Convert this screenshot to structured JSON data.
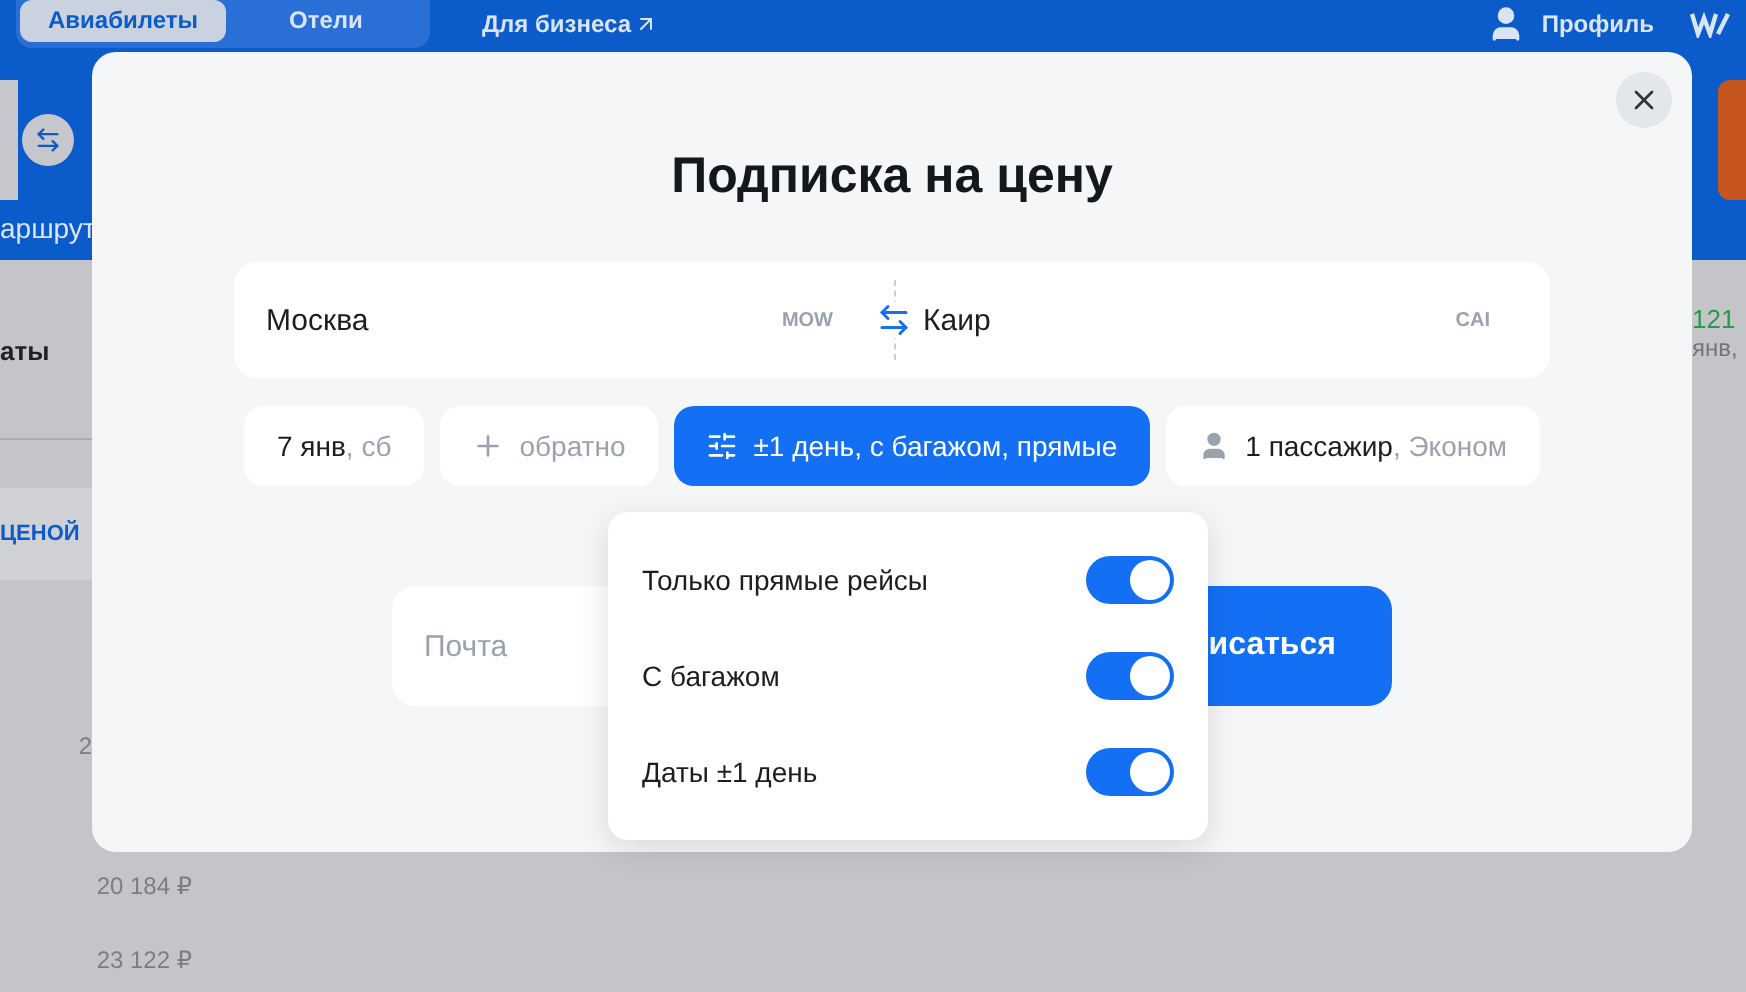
{
  "nav": {
    "tabs": [
      {
        "label": "Авиабилеты",
        "selected": true
      },
      {
        "label": "Отели",
        "selected": false
      }
    ],
    "business_link": "Для бизнеса",
    "profile": "Профиль"
  },
  "background": {
    "route_label": "аршрут",
    "dates_label": "аты",
    "price_banner": "ЦЕНОЙ",
    "best_price": "121",
    "best_date": "янв,",
    "prices": [
      "2",
      "20 184 ₽",
      "23 122 ₽"
    ]
  },
  "modal": {
    "title": "Подписка на цену",
    "origin": {
      "city": "Москва",
      "code": "MOW"
    },
    "destination": {
      "city": "Каир",
      "code": "CAI"
    },
    "depart": {
      "date": "7 янв",
      "weekday": ", сб"
    },
    "return": {
      "placeholder": "обратно"
    },
    "filters": {
      "label": "±1 день, с багажом, прямые",
      "expanded": true
    },
    "passengers": {
      "count": "1 пассажир",
      "cabin": ", Эконом"
    },
    "email": {
      "placeholder": "Почта"
    },
    "subscribe": "исаться",
    "options": [
      {
        "label": "Только прямые рейсы",
        "on": true
      },
      {
        "label": "С багажом",
        "on": true
      },
      {
        "label": "Даты ±1 день",
        "on": true
      }
    ]
  }
}
